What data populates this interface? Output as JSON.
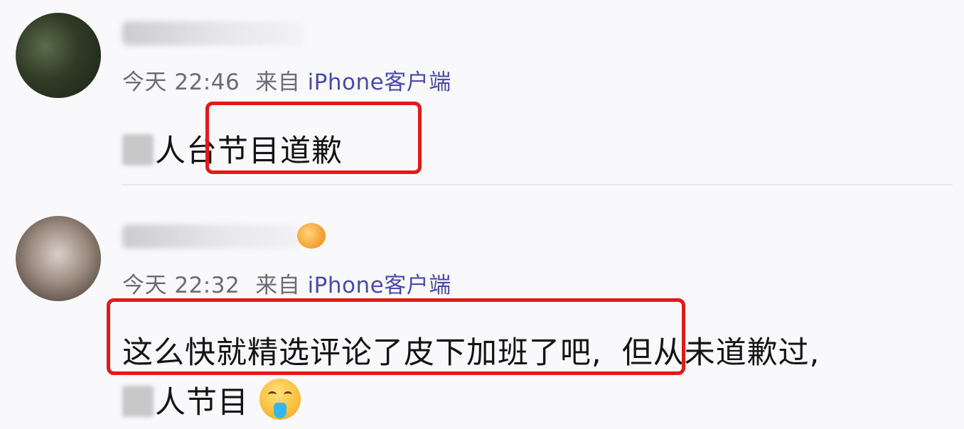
{
  "comments": [
    {
      "meta_day": "今天",
      "meta_time": "22:46",
      "meta_from": "来自",
      "meta_client": "iPhone客户端",
      "content_text": "人台节目道歉"
    },
    {
      "meta_day": "今天",
      "meta_time": "22:32",
      "meta_from": "来自",
      "meta_client": "iPhone客户端",
      "content_line1_highlight": "这么快就精选评论了皮下加班了吧,",
      "content_line1_rest": "但从未道歉过,",
      "content_line2": "人节目"
    }
  ],
  "colors": {
    "highlight_border": "#e4181a",
    "meta_text": "#6b6b78",
    "client_text": "#4b4aa8"
  },
  "icons": [
    "avatar-image",
    "fish-emoji-icon",
    "vomit-face-emoji-icon"
  ]
}
